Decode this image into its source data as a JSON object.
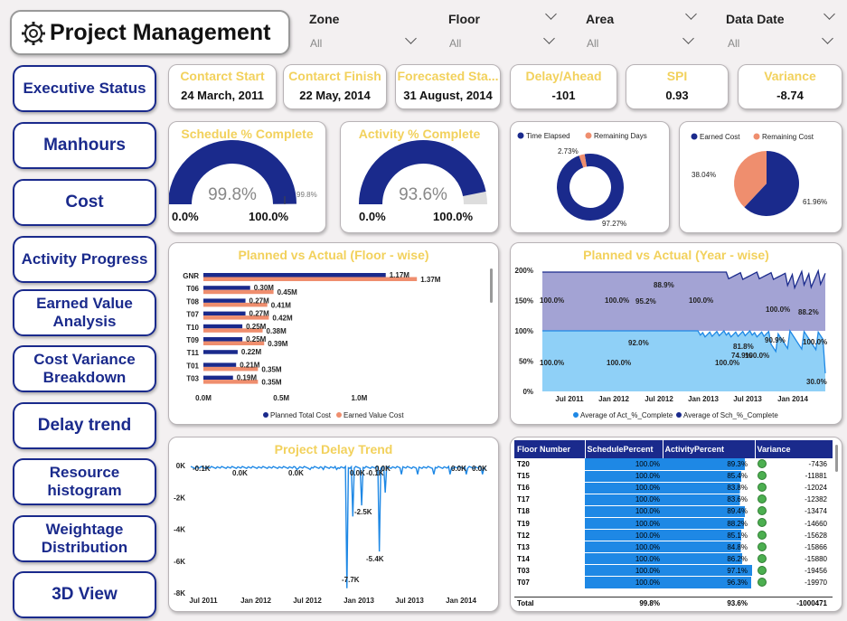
{
  "title": "Project Management",
  "filters": [
    {
      "label": "Zone",
      "value": "All"
    },
    {
      "label": "Floor",
      "value": "All"
    },
    {
      "label": "Area",
      "value": "All"
    },
    {
      "label": "Data Date",
      "value": "All"
    }
  ],
  "nav": [
    "Executive Status",
    "Manhours",
    "Cost",
    "Activity Progress",
    "Earned Value Analysis",
    "Cost Variance Breakdown",
    "Delay trend",
    "Resource histogram",
    "Weightage Distribution",
    "3D View"
  ],
  "kpis": [
    {
      "title": "Contarct Start",
      "value": "24 March, 2011"
    },
    {
      "title": "Contarct Finish",
      "value": "22 May, 2014"
    },
    {
      "title": "Forecasted Sta...",
      "value": "31 August, 2014"
    },
    {
      "title": "Delay/Ahead",
      "value": "-101"
    },
    {
      "title": "SPI",
      "value": "0.93"
    },
    {
      "title": "Variance",
      "value": "-8.74"
    }
  ],
  "gauges": [
    {
      "title": "Schedule % Complete",
      "value": "99.8%",
      "fraction": 0.998,
      "min": "0.0%",
      "max": "100.0%",
      "target": "99.8%"
    },
    {
      "title": "Activity % Complete",
      "value": "93.6%",
      "fraction": 0.936,
      "min": "0.0%",
      "max": "100.0%"
    }
  ],
  "colors": {
    "navy": "#1a2a8c",
    "salmon": "#ef8e6e",
    "gold": "#f2d15c",
    "lightblue": "#8fd0f7",
    "lavender": "#a3a3d4",
    "green": "#4caf50",
    "blue_bar": "#1e88e5"
  },
  "chart_data": [
    {
      "type": "pie",
      "subtype": "donut",
      "legend": [
        "Time Elapsed",
        "Remaining Days"
      ],
      "values": [
        97.27,
        2.73
      ],
      "labels": [
        "97.27%",
        "2.73%"
      ]
    },
    {
      "type": "pie",
      "legend": [
        "Earned Cost",
        "Remaining Cost"
      ],
      "values": [
        61.96,
        38.04
      ],
      "labels": [
        "61.96%",
        "38.04%"
      ]
    },
    {
      "type": "bar",
      "orientation": "horizontal",
      "title": "Planned vs Actual (Floor - wise)",
      "categories": [
        "GNR",
        "T06",
        "T08",
        "T07",
        "T10",
        "T09",
        "T11",
        "T01",
        "T03"
      ],
      "series": [
        {
          "name": "Planned Total Cost",
          "values": [
            1.17,
            0.3,
            0.27,
            0.27,
            0.25,
            0.25,
            0.22,
            0.21,
            0.19
          ],
          "labels": [
            "1.17M",
            "0.30M",
            "0.27M",
            "0.27M",
            "0.25M",
            "0.25M",
            "0.22M",
            "0.21M",
            "0.19M"
          ]
        },
        {
          "name": "Earned Value Cost",
          "values": [
            1.37,
            0.45,
            0.41,
            0.42,
            0.38,
            0.39,
            null,
            0.35,
            0.35
          ],
          "labels": [
            "1.37M",
            "0.45M",
            "0.41M",
            "0.42M",
            "0.38M",
            "0.39M",
            "",
            "0.35M",
            "0.35M"
          ]
        }
      ],
      "xticks": [
        "0.0M",
        "0.5M",
        "1.0M"
      ],
      "xlim": [
        0,
        1.45
      ]
    },
    {
      "type": "area",
      "title": "Planned vs Actual (Year - wise)",
      "yticks": [
        "0%",
        "50%",
        "100%",
        "150%",
        "200%"
      ],
      "ylim": [
        0,
        200
      ],
      "xticks": [
        "Jul 2011",
        "Jan 2012",
        "Jul 2012",
        "Jan 2013",
        "Jul 2013",
        "Jan 2014"
      ],
      "series": [
        {
          "name": "Average of Act_%_Complete",
          "labels": [
            "100.0%",
            "100.0%",
            "92.0%",
            "100.0%",
            "81.8%",
            "74.9%",
            "100.0%",
            "90.9%",
            "100.0%",
            "30.0%"
          ]
        },
        {
          "name": "Average of Sch_%_Complete",
          "labels": [
            "100.0%",
            "100.0%",
            "95.2%",
            "88.9%",
            "100.0%",
            "100.0%",
            "88.2%"
          ]
        }
      ]
    },
    {
      "type": "line",
      "title": "Project Delay Trend",
      "yticks": [
        "0K",
        "-2K",
        "-4K",
        "-6K",
        "-8K"
      ],
      "ylim": [
        -8000,
        0
      ],
      "xticks": [
        "Jul 2011",
        "Jan 2012",
        "Jul 2012",
        "Jan 2013",
        "Jul 2013",
        "Jan 2014"
      ],
      "annotations": [
        "-0.1K",
        "0.0K",
        "0.0K",
        "0.0K",
        "-0.1K",
        "0.0K",
        "0.0K",
        "0.0K",
        "-2.5K",
        "-5.4K",
        "-7.7K"
      ]
    },
    {
      "type": "table",
      "columns": [
        "Floor Number",
        "SchedulePercent",
        "ActivityPercent",
        "Variance"
      ],
      "rows": [
        [
          "T20",
          "100.0%",
          "89.3%",
          "-7436"
        ],
        [
          "T15",
          "100.0%",
          "85.4%",
          "-11881"
        ],
        [
          "T16",
          "100.0%",
          "83.8%",
          "-12024"
        ],
        [
          "T17",
          "100.0%",
          "83.6%",
          "-12382"
        ],
        [
          "T18",
          "100.0%",
          "89.4%",
          "-13474"
        ],
        [
          "T19",
          "100.0%",
          "88.2%",
          "-14660"
        ],
        [
          "T12",
          "100.0%",
          "85.1%",
          "-15628"
        ],
        [
          "T13",
          "100.0%",
          "84.8%",
          "-15866"
        ],
        [
          "T14",
          "100.0%",
          "86.2%",
          "-15880"
        ],
        [
          "T03",
          "100.0%",
          "97.1%",
          "-19456"
        ],
        [
          "T07",
          "100.0%",
          "96.3%",
          "-19970"
        ]
      ],
      "total": [
        "Total",
        "99.8%",
        "93.6%",
        "-1000471"
      ]
    }
  ]
}
